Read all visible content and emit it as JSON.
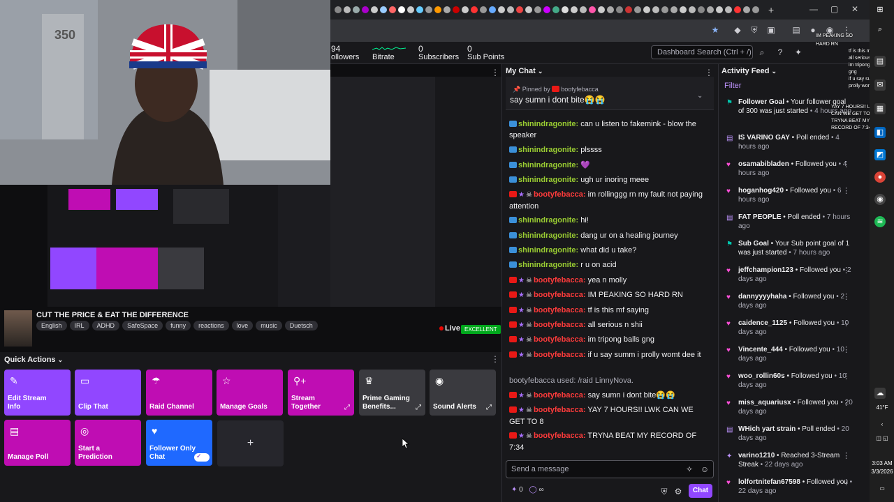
{
  "header": {
    "followers_count": "94",
    "followers_label": "ollowers",
    "bitrate_label": "Bitrate",
    "subscribers_count": "0",
    "subscribers_label": "Subscribers",
    "subpoints_count": "0",
    "subpoints_label": "Sub Points",
    "search_placeholder": "Dashboard Search (Ctrl + /)"
  },
  "webcam": {
    "hat_text": "350"
  },
  "stream": {
    "title": "CUT THE PRICE & EAT THE DIFFERENCE",
    "tags": [
      "English",
      "IRL",
      "ADHD",
      "SafeSpace",
      "funny",
      "reactions",
      "love",
      "music",
      "Duetsch"
    ],
    "live_label": "Live",
    "health_badge": "EXCELLENT"
  },
  "quick_actions": {
    "header": "Quick Actions",
    "tiles": [
      {
        "label": "Edit Stream Info",
        "icon": "pencil-icon",
        "color": "#9147ff"
      },
      {
        "label": "Clip That",
        "icon": "clip-icon",
        "color": "#9147ff"
      },
      {
        "label": "Raid Channel",
        "icon": "raid-icon",
        "color": "#bf0db3"
      },
      {
        "label": "Manage Goals",
        "icon": "star-icon",
        "color": "#bf0db3"
      },
      {
        "label": "Stream Together",
        "icon": "person-plus-icon",
        "color": "#bf0db3"
      },
      {
        "label": "Prime Gaming Benefits...",
        "icon": "crown-icon",
        "color": "#3a3a3f"
      },
      {
        "label": "Sound Alerts",
        "icon": "sound-alerts-icon",
        "color": "#3a3a3f"
      },
      {
        "label": "Manage Poll",
        "icon": "poll-icon",
        "color": "#bf0db3"
      },
      {
        "label": "Start a Prediction",
        "icon": "prediction-icon",
        "color": "#bf0db3"
      },
      {
        "label": "Follower Only Chat",
        "icon": "heart-icon",
        "color": "#1f69ff"
      }
    ],
    "add_label": "+"
  },
  "chat": {
    "header": "My Chat",
    "pinned_by": "Pinned by",
    "pinned_user": "bootyfebacca",
    "pinned_message": "say sumn i dont bite😭😭",
    "messages": [
      {
        "user": "shinindragonite:",
        "text": " can u listen to fakemink - blow the speaker",
        "type": "blue"
      },
      {
        "user": "shinindragonite:",
        "text": " plssss",
        "type": "blue"
      },
      {
        "user": "shinindragonite:",
        "text": " 💜",
        "type": "blue"
      },
      {
        "user": "shinindragonite:",
        "text": " ugh ur inoring meee",
        "type": "blue"
      },
      {
        "user": "bootyfebacca:",
        "text": " im rollinggg rn my fault not paying attention",
        "type": "red"
      },
      {
        "user": "shinindragonite:",
        "text": " hi!",
        "type": "blue"
      },
      {
        "user": "shinindragonite:",
        "text": " dang ur on a healing journey",
        "type": "blue"
      },
      {
        "user": "shinindragonite:",
        "text": " what did u take?",
        "type": "blue"
      },
      {
        "user": "shinindragonite:",
        "text": " r u on acid",
        "type": "blue"
      },
      {
        "user": "bootyfebacca:",
        "text": " yea n molly",
        "type": "red"
      },
      {
        "user": "bootyfebacca:",
        "text": " IM PEAKING SO HARD RN",
        "type": "red"
      },
      {
        "user": "bootyfebacca:",
        "text": " tf is this mf saying",
        "type": "red"
      },
      {
        "user": "bootyfebacca:",
        "text": " all serious n shii",
        "type": "red"
      },
      {
        "user": "bootyfebacca:",
        "text": " im tripong balls gng",
        "type": "red"
      },
      {
        "user": "bootyfebacca:",
        "text": " if u say summ i prolly womt dee it",
        "type": "red"
      },
      {
        "user": "",
        "text": "bootyfebacca used: /raid LinnyNova.",
        "type": "system"
      },
      {
        "user": "bootyfebacca:",
        "text": " say sumn i dont bite😭😭",
        "type": "red"
      },
      {
        "user": "bootyfebacca:",
        "text": " YAY 7 HOURS!! LWK CAN WE GET TO 8",
        "type": "red"
      },
      {
        "user": "bootyfebacca:",
        "text": " TRYNA BEAT MY RECORD OF 7:34",
        "type": "red"
      }
    ],
    "input_placeholder": "Send a message",
    "points": "0",
    "infinity": "∞",
    "send_label": "Chat"
  },
  "activity": {
    "header": "Activity Feed",
    "filter": "Filter",
    "items": [
      {
        "icon": "trophy-icon",
        "color": "#00c8af",
        "title": "Follower Goal",
        "text": " • Your follower goal of 300 was just started",
        "time": " • 4 hours ago"
      },
      {
        "icon": "poll-icon",
        "color": "#bf94ff",
        "title": "IS VARINO GAY",
        "text": " • Poll ended",
        "time": " • 4 hours ago"
      },
      {
        "icon": "heart-icon",
        "color": "#ff4fd8",
        "title": "osamabibladen",
        "text": " • Followed you",
        "time": " • 4 hours ago"
      },
      {
        "icon": "heart-icon",
        "color": "#ff4fd8",
        "title": "hoganhog420",
        "text": " • Followed you",
        "time": " • 6 hours ago"
      },
      {
        "icon": "poll-icon",
        "color": "#bf94ff",
        "title": "FAT PEOPLE",
        "text": " • Poll ended",
        "time": " • 7 hours ago"
      },
      {
        "icon": "trophy-icon",
        "color": "#00c8af",
        "title": "Sub Goal",
        "text": " • Your Sub point goal of 1 was just started",
        "time": " • 7 hours ago"
      },
      {
        "icon": "heart-icon",
        "color": "#ff4fd8",
        "title": "jeffchampion123",
        "text": " • Followed you",
        "time": " • 2 days ago"
      },
      {
        "icon": "heart-icon",
        "color": "#ff4fd8",
        "title": "dannyyyyhaha",
        "text": " • Followed you",
        "time": " • 2 days ago"
      },
      {
        "icon": "heart-icon",
        "color": "#ff4fd8",
        "title": "caidence_1125",
        "text": " • Followed you",
        "time": " • 10 days ago"
      },
      {
        "icon": "heart-icon",
        "color": "#ff4fd8",
        "title": "Vincente_444",
        "text": " • Followed you",
        "time": " • 10 days ago"
      },
      {
        "icon": "heart-icon",
        "color": "#ff4fd8",
        "title": "woo_rollin60s",
        "text": " • Followed you",
        "time": " • 10 days ago"
      },
      {
        "icon": "heart-icon",
        "color": "#ff4fd8",
        "title": "miss_aquariusx",
        "text": " • Followed you",
        "time": " • 20 days ago"
      },
      {
        "icon": "poll-icon",
        "color": "#bf94ff",
        "title": "WHich yart strain",
        "text": " • Poll ended",
        "time": " • 20 days ago"
      },
      {
        "icon": "star-icon",
        "color": "#bf94ff",
        "title": "varino1210",
        "text": " • Reached 3-Stream Streak",
        "time": " • 22 days ago"
      },
      {
        "icon": "heart-icon",
        "color": "#ff4fd8",
        "title": "lolfortnitefan67598",
        "text": " • Followed you",
        "time": " • 22 days ago"
      }
    ]
  },
  "overlay_texts": [
    "IM PEAKING SO",
    "HARD RN",
    "tf is this mf saying",
    "all serious n shii",
    "im tripong balls",
    "gng",
    "if u say summ i",
    "prolly womt dee it",
    "YAY 7 HOURS!! LWK",
    "CAN WE GET TO 8",
    "TRYNA BEAT MY",
    "RECORD OF 7:34"
  ],
  "taskbar": {
    "weather": "41°F",
    "time": "3:03 AM",
    "date": "3/3/2026"
  }
}
